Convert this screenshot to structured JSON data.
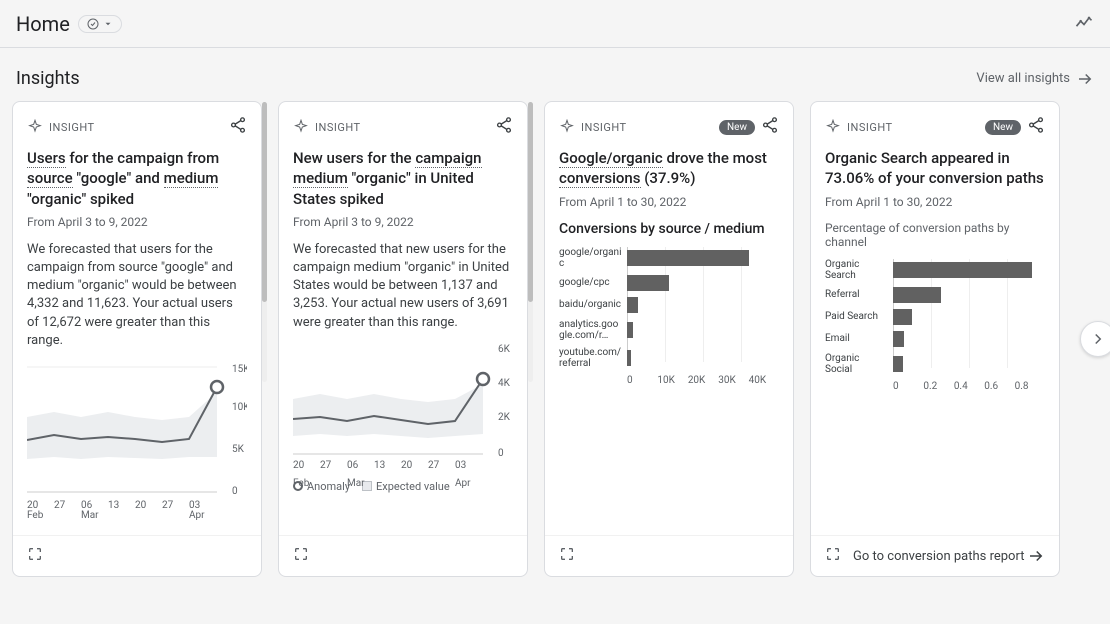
{
  "header": {
    "title": "Home"
  },
  "section": {
    "title": "Insights",
    "view_all": "View all insights"
  },
  "cards": [
    {
      "label": "INSIGHT",
      "title_parts": {
        "a": "Users",
        "b": " for the campaign from ",
        "c": "source",
        "d": " \"google\" and ",
        "e": "medium",
        "f": " \"organic\" spiked"
      },
      "date_range": "From April 3 to 9, 2022",
      "description": "We forecasted that users for the campaign from source \"google\" and medium \"organic\" would be between 4,332 and 11,623. Your actual users of 12,672 were greater than this range."
    },
    {
      "label": "INSIGHT",
      "title_parts": {
        "a": "New users for the ",
        "b": "campaign medium",
        "c": " \"organic\" in United States spiked"
      },
      "date_range": "From April 3 to 9, 2022",
      "description": "We forecasted that new users for the campaign medium \"organic\" in United States would be between 1,137 and 3,253. Your actual new users of 3,691 were greater than this range.",
      "legend": {
        "anomaly": "Anomaly",
        "expected": "Expected value"
      }
    },
    {
      "label": "INSIGHT",
      "badge": "New",
      "title_parts": {
        "a": "Google/organic",
        "b": " drove the most ",
        "c": "conversions",
        "d": " (37.9%)"
      },
      "date_range": "From April 1 to 30, 2022",
      "subhead": "Conversions by source / medium"
    },
    {
      "label": "INSIGHT",
      "badge": "New",
      "title": "Organic Search appeared in 73.06% of your conversion paths",
      "date_range": "From April 1 to 30, 2022",
      "subhead": "Percentage of conversion paths by channel",
      "footer_link": "Go to conversion paths report"
    }
  ],
  "chart_data": [
    {
      "type": "line",
      "title": "",
      "x_labels": [
        "20 Feb",
        "27",
        "06 Mar",
        "13",
        "20",
        "27",
        "03 Apr"
      ],
      "y_ticks": [
        0,
        "5K",
        "10K",
        "15K"
      ],
      "values": [
        6200,
        6800,
        6400,
        6600,
        6400,
        6000,
        6300,
        12672
      ],
      "lower_band": [
        4000,
        4200,
        4100,
        4300,
        4200,
        4100,
        4200,
        4332
      ],
      "upper_band": [
        9000,
        9200,
        9000,
        9300,
        9100,
        9000,
        9200,
        11623
      ],
      "ylim": [
        0,
        15000
      ],
      "anomaly_index": 7
    },
    {
      "type": "line",
      "title": "",
      "x_labels": [
        "20 Feb",
        "27",
        "06 Mar",
        "13",
        "20",
        "27",
        "03 Apr"
      ],
      "y_ticks": [
        0,
        "2K",
        "4K",
        "6K"
      ],
      "values": [
        1900,
        2000,
        1800,
        2100,
        1900,
        1700,
        1800,
        3691
      ],
      "lower_band": [
        1100,
        1150,
        1120,
        1180,
        1150,
        1120,
        1150,
        1137
      ],
      "upper_band": [
        2800,
        2900,
        2850,
        2950,
        2900,
        2850,
        2900,
        3253
      ],
      "ylim": [
        0,
        6000
      ],
      "anomaly_index": 7
    },
    {
      "type": "bar",
      "orientation": "horizontal",
      "categories": [
        "google/organic",
        "google/cpc",
        "baidu/organic",
        "analytics.google.com/r…",
        "youtube.com/referral"
      ],
      "values": [
        32000,
        11000,
        3000,
        1500,
        1000
      ],
      "x_ticks": [
        "0",
        "10K",
        "20K",
        "30K",
        "40K"
      ],
      "xlim": [
        0,
        40000
      ]
    },
    {
      "type": "bar",
      "orientation": "horizontal",
      "categories": [
        "Organic Search",
        "Referral",
        "Paid Search",
        "Email",
        "Organic Social"
      ],
      "values": [
        0.73,
        0.25,
        0.1,
        0.06,
        0.05
      ],
      "x_ticks": [
        "0",
        "0.2",
        "0.4",
        "0.6",
        "0.8"
      ],
      "xlim": [
        0,
        0.8
      ]
    }
  ]
}
